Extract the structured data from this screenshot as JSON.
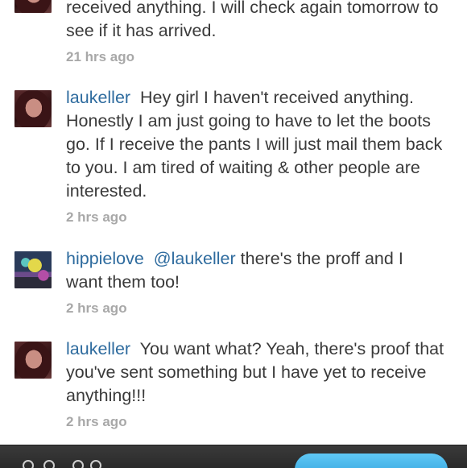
{
  "comments": [
    {
      "username": "",
      "mention": "",
      "text": "received anything. I will check again tomorrow to see if it has arrived.",
      "time": "21 hrs ago",
      "avatar": "girl-avatar"
    },
    {
      "username": "laukeller",
      "mention": "",
      "text": "Hey girl I haven't received anything. Honestly I am just going to have to let the boots go. If I receive the pants I will just mail them back to you. I am tired of waiting & other people are interested.",
      "time": "2 hrs ago",
      "avatar": "girl-avatar"
    },
    {
      "username": "hippielove",
      "mention": "@laukeller",
      "text": "there's the proff and I want them too!",
      "time": "2 hrs ago",
      "avatar": "cartoon-avatar"
    },
    {
      "username": "laukeller",
      "mention": "",
      "text": "You want what? Yeah, there's proof that you've sent something but I have yet to receive anything!!!",
      "time": "2 hrs ago",
      "avatar": "girl-avatar"
    }
  ],
  "colors": {
    "username": "#2e6b9e",
    "body_text": "#3a3a3a",
    "timestamp": "#a8a8a8",
    "bottom_bar": "#2f2f2f",
    "action_button": "#3aa6e4"
  }
}
